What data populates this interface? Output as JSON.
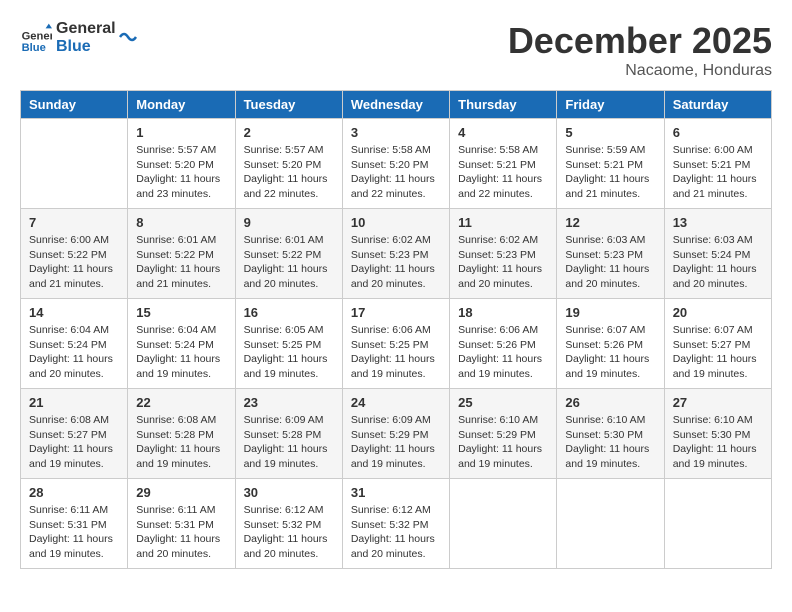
{
  "header": {
    "logo_line1": "General",
    "logo_line2": "Blue",
    "month": "December 2025",
    "location": "Nacaome, Honduras"
  },
  "weekdays": [
    "Sunday",
    "Monday",
    "Tuesday",
    "Wednesday",
    "Thursday",
    "Friday",
    "Saturday"
  ],
  "weeks": [
    [
      {
        "day": "",
        "info": ""
      },
      {
        "day": "1",
        "info": "Sunrise: 5:57 AM\nSunset: 5:20 PM\nDaylight: 11 hours\nand 23 minutes."
      },
      {
        "day": "2",
        "info": "Sunrise: 5:57 AM\nSunset: 5:20 PM\nDaylight: 11 hours\nand 22 minutes."
      },
      {
        "day": "3",
        "info": "Sunrise: 5:58 AM\nSunset: 5:20 PM\nDaylight: 11 hours\nand 22 minutes."
      },
      {
        "day": "4",
        "info": "Sunrise: 5:58 AM\nSunset: 5:21 PM\nDaylight: 11 hours\nand 22 minutes."
      },
      {
        "day": "5",
        "info": "Sunrise: 5:59 AM\nSunset: 5:21 PM\nDaylight: 11 hours\nand 21 minutes."
      },
      {
        "day": "6",
        "info": "Sunrise: 6:00 AM\nSunset: 5:21 PM\nDaylight: 11 hours\nand 21 minutes."
      }
    ],
    [
      {
        "day": "7",
        "info": "Sunrise: 6:00 AM\nSunset: 5:22 PM\nDaylight: 11 hours\nand 21 minutes."
      },
      {
        "day": "8",
        "info": "Sunrise: 6:01 AM\nSunset: 5:22 PM\nDaylight: 11 hours\nand 21 minutes."
      },
      {
        "day": "9",
        "info": "Sunrise: 6:01 AM\nSunset: 5:22 PM\nDaylight: 11 hours\nand 20 minutes."
      },
      {
        "day": "10",
        "info": "Sunrise: 6:02 AM\nSunset: 5:23 PM\nDaylight: 11 hours\nand 20 minutes."
      },
      {
        "day": "11",
        "info": "Sunrise: 6:02 AM\nSunset: 5:23 PM\nDaylight: 11 hours\nand 20 minutes."
      },
      {
        "day": "12",
        "info": "Sunrise: 6:03 AM\nSunset: 5:23 PM\nDaylight: 11 hours\nand 20 minutes."
      },
      {
        "day": "13",
        "info": "Sunrise: 6:03 AM\nSunset: 5:24 PM\nDaylight: 11 hours\nand 20 minutes."
      }
    ],
    [
      {
        "day": "14",
        "info": "Sunrise: 6:04 AM\nSunset: 5:24 PM\nDaylight: 11 hours\nand 20 minutes."
      },
      {
        "day": "15",
        "info": "Sunrise: 6:04 AM\nSunset: 5:24 PM\nDaylight: 11 hours\nand 19 minutes."
      },
      {
        "day": "16",
        "info": "Sunrise: 6:05 AM\nSunset: 5:25 PM\nDaylight: 11 hours\nand 19 minutes."
      },
      {
        "day": "17",
        "info": "Sunrise: 6:06 AM\nSunset: 5:25 PM\nDaylight: 11 hours\nand 19 minutes."
      },
      {
        "day": "18",
        "info": "Sunrise: 6:06 AM\nSunset: 5:26 PM\nDaylight: 11 hours\nand 19 minutes."
      },
      {
        "day": "19",
        "info": "Sunrise: 6:07 AM\nSunset: 5:26 PM\nDaylight: 11 hours\nand 19 minutes."
      },
      {
        "day": "20",
        "info": "Sunrise: 6:07 AM\nSunset: 5:27 PM\nDaylight: 11 hours\nand 19 minutes."
      }
    ],
    [
      {
        "day": "21",
        "info": "Sunrise: 6:08 AM\nSunset: 5:27 PM\nDaylight: 11 hours\nand 19 minutes."
      },
      {
        "day": "22",
        "info": "Sunrise: 6:08 AM\nSunset: 5:28 PM\nDaylight: 11 hours\nand 19 minutes."
      },
      {
        "day": "23",
        "info": "Sunrise: 6:09 AM\nSunset: 5:28 PM\nDaylight: 11 hours\nand 19 minutes."
      },
      {
        "day": "24",
        "info": "Sunrise: 6:09 AM\nSunset: 5:29 PM\nDaylight: 11 hours\nand 19 minutes."
      },
      {
        "day": "25",
        "info": "Sunrise: 6:10 AM\nSunset: 5:29 PM\nDaylight: 11 hours\nand 19 minutes."
      },
      {
        "day": "26",
        "info": "Sunrise: 6:10 AM\nSunset: 5:30 PM\nDaylight: 11 hours\nand 19 minutes."
      },
      {
        "day": "27",
        "info": "Sunrise: 6:10 AM\nSunset: 5:30 PM\nDaylight: 11 hours\nand 19 minutes."
      }
    ],
    [
      {
        "day": "28",
        "info": "Sunrise: 6:11 AM\nSunset: 5:31 PM\nDaylight: 11 hours\nand 19 minutes."
      },
      {
        "day": "29",
        "info": "Sunrise: 6:11 AM\nSunset: 5:31 PM\nDaylight: 11 hours\nand 20 minutes."
      },
      {
        "day": "30",
        "info": "Sunrise: 6:12 AM\nSunset: 5:32 PM\nDaylight: 11 hours\nand 20 minutes."
      },
      {
        "day": "31",
        "info": "Sunrise: 6:12 AM\nSunset: 5:32 PM\nDaylight: 11 hours\nand 20 minutes."
      },
      {
        "day": "",
        "info": ""
      },
      {
        "day": "",
        "info": ""
      },
      {
        "day": "",
        "info": ""
      }
    ]
  ]
}
